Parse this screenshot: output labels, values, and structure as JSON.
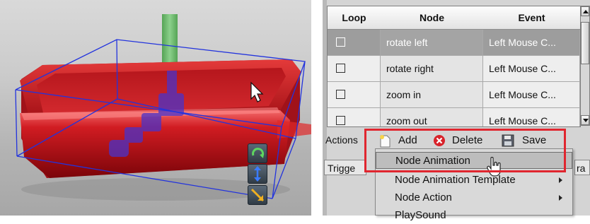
{
  "viewport": {
    "tools": [
      {
        "icon": "rotate-icon"
      },
      {
        "icon": "move-arrows-icon"
      },
      {
        "icon": "scale-icon"
      }
    ]
  },
  "table": {
    "columns": [
      "Loop",
      "Node",
      "Event"
    ],
    "rows": [
      {
        "loop": false,
        "node": "rotate left",
        "event": "Left Mouse C...",
        "selected": true
      },
      {
        "loop": false,
        "node": "rotate right",
        "event": "Left Mouse C...",
        "selected": false
      },
      {
        "loop": false,
        "node": "zoom in",
        "event": "Left Mouse C...",
        "selected": false
      },
      {
        "loop": false,
        "node": "zoom out",
        "event": "Left Mouse C...",
        "selected": false
      }
    ]
  },
  "actions": {
    "label": "Actions",
    "add": "Add",
    "delete": "Delete",
    "save": "Save"
  },
  "trigger": {
    "label": "Trigge",
    "right_fragment": "ra"
  },
  "menu": {
    "items": [
      {
        "label": "Node Animation",
        "submenu": false,
        "highlighted": true
      },
      {
        "label": "Node Animation Template",
        "submenu": true,
        "highlighted": false
      },
      {
        "label": "Node Action",
        "submenu": true,
        "highlighted": false
      },
      {
        "label": "PlaySound",
        "submenu": false,
        "highlighted": false
      }
    ]
  },
  "colors": {
    "highlight_box": "#e0262f",
    "object_red": "#c0141c",
    "bbox_blue": "#2233dd"
  }
}
